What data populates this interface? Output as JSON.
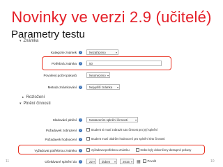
{
  "slide": {
    "title": "Novinky ve verzi 2.9 (učitelé)",
    "subtitle": "Parametry testu",
    "page_left": "11",
    "page_right": "10"
  },
  "form": {
    "sections": {
      "grade": "Známka",
      "appearance": "Rozložení",
      "completion": "Plnění činnosti"
    },
    "grade_category": {
      "label": "Kategorie známek",
      "value": "Nezařazeno"
    },
    "grade_to_pass": {
      "label": "Potřebná známka",
      "value": "50"
    },
    "attempts": {
      "label": "Povolený počet pokusů",
      "value": "Neomezeno"
    },
    "grading_method": {
      "label": "Metoda známkování",
      "value": "Nejvyšší známka"
    },
    "completion_tracking": {
      "label": "Sledování plnění",
      "value": "Nastavením splnění činnosti"
    },
    "require_view": {
      "label": "Požadavek zobrazení",
      "checkbox": "Student si musí zobrazit tuto činnost pro její splnění"
    },
    "require_grade": {
      "label": "Požadavek hodnocení",
      "checkbox": "Student musí obdržet hodnocení pro splnění této činnosti"
    },
    "require_passing": {
      "label": "Vyžadovat potřebnou známku",
      "option1": "Vyžadovat potřebnou známku",
      "option2": "Nebo byly dokončeny dostupné pokusy"
    },
    "expected_completion": {
      "label": "Očekávané splnění do",
      "day": "22",
      "month": "duben",
      "year": "2015",
      "enable": "Povolit"
    }
  }
}
